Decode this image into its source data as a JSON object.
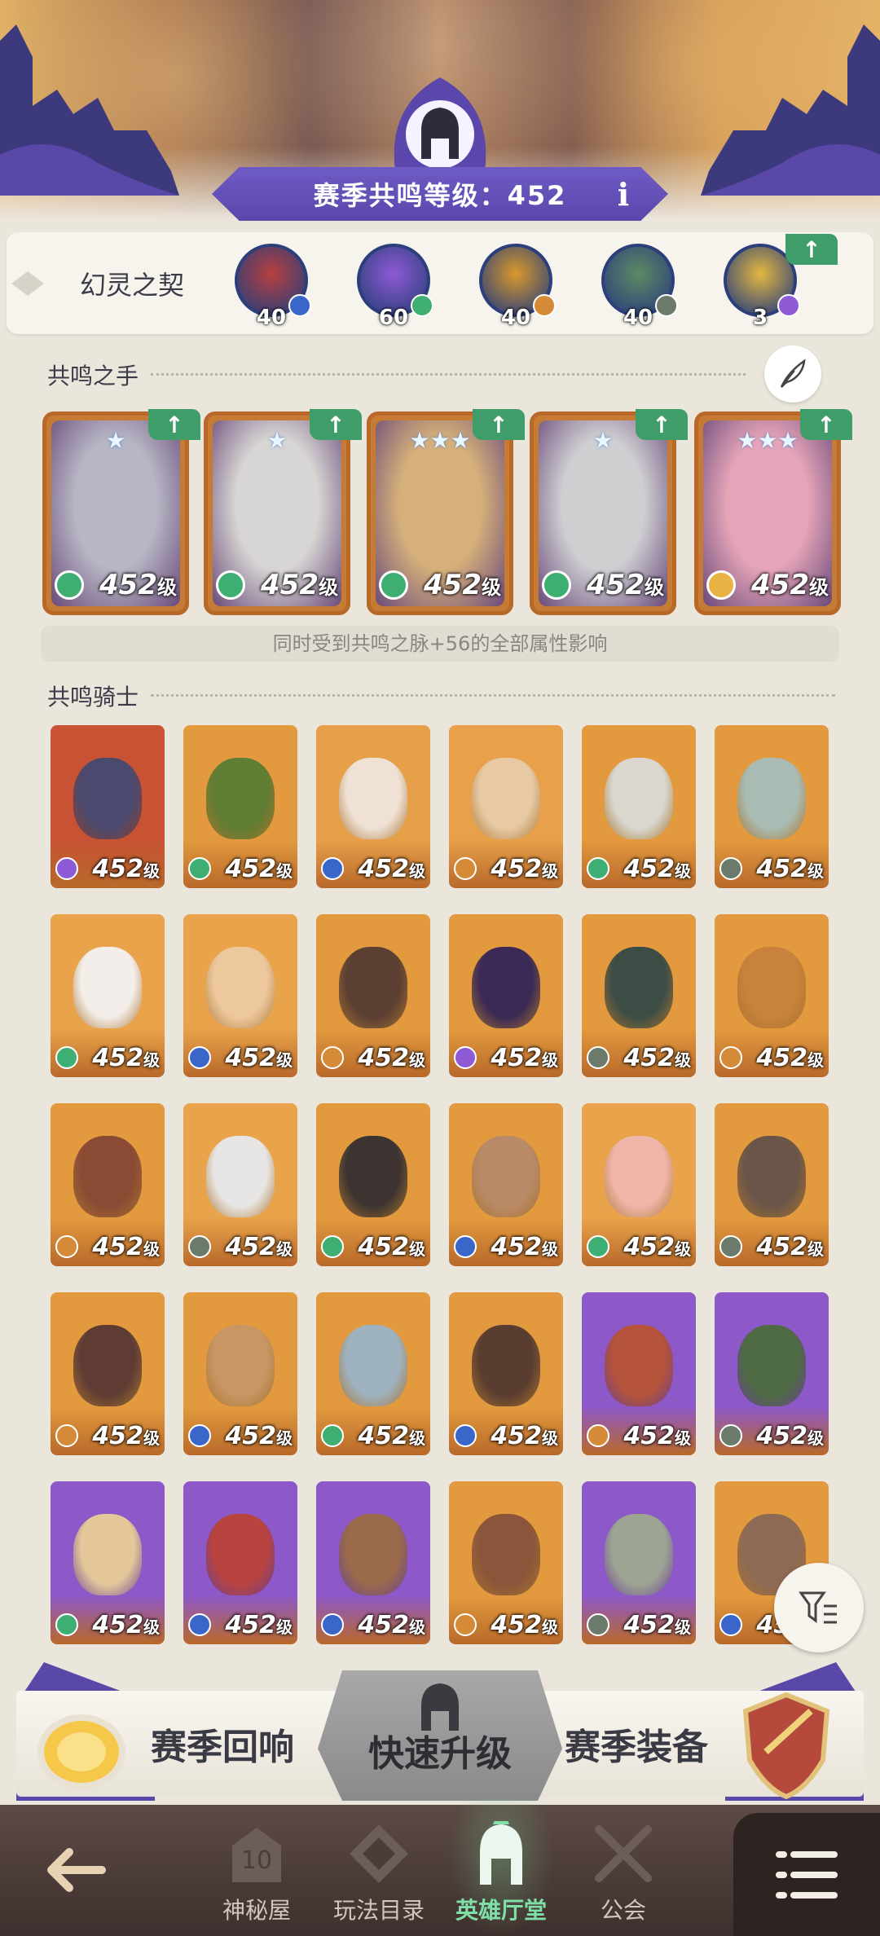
{
  "header": {
    "season_level_label": "赛季共鸣等级：452",
    "info_icon": "i"
  },
  "phantom": {
    "title": "幻灵之契",
    "items": [
      {
        "level": "40",
        "color": "#b63f3f",
        "elem": "#3b66c9"
      },
      {
        "level": "60",
        "color": "#8e5ad6",
        "elem": "#3fae73"
      },
      {
        "level": "40",
        "color": "#d99a2b",
        "elem": "#d48a36"
      },
      {
        "level": "40",
        "color": "#5e8a64",
        "elem": "#6b7a6a"
      },
      {
        "level": "3",
        "color": "#e3b840",
        "elem": "#8e5ad6"
      }
    ],
    "upgrade_badge": "↑"
  },
  "hands": {
    "title": "共鸣之手",
    "items": [
      {
        "stars": "★",
        "level": "452",
        "unit": "级",
        "color": "#b7b6c4",
        "elem": "#3fae73"
      },
      {
        "stars": "★",
        "level": "452",
        "unit": "级",
        "color": "#d8d6d4",
        "elem": "#3fae73"
      },
      {
        "stars": "★★★",
        "level": "452",
        "unit": "级",
        "color": "#d6b07a",
        "elem": "#3fae73"
      },
      {
        "stars": "★",
        "level": "452",
        "unit": "级",
        "color": "#cfcfd2",
        "elem": "#3fae73"
      },
      {
        "stars": "★★★",
        "level": "452",
        "unit": "级",
        "color": "#e5a4b8",
        "elem": "#e9b344"
      }
    ],
    "note": "同时受到共鸣之脉+56的全部属性影响"
  },
  "knights": {
    "title": "共鸣骑士",
    "level": "452",
    "unit": "级",
    "rows": [
      [
        {
          "bg": "#c75234",
          "face": "#4b4a6e",
          "elem": "#8e5ad6"
        },
        {
          "bg": "#e39a3e",
          "face": "#5f7d33",
          "elem": "#3fae73"
        },
        {
          "bg": "#e6a04a",
          "face": "#efe1d4",
          "elem": "#3b66c9"
        },
        {
          "bg": "#e8a04a",
          "face": "#e7c9a3",
          "elem": "#d48a36"
        },
        {
          "bg": "#e39a3e",
          "face": "#d9d7ce",
          "elem": "#3fae73"
        },
        {
          "bg": "#e39a3e",
          "face": "#a9bcb3",
          "elem": "#6b7a6a"
        }
      ],
      [
        {
          "bg": "#e9a34a",
          "face": "#f3eee9",
          "elem": "#3fae73"
        },
        {
          "bg": "#e9a34a",
          "face": "#edc89d",
          "elem": "#3b66c9"
        },
        {
          "bg": "#e39a3e",
          "face": "#5b3f33",
          "elem": "#d48a36"
        },
        {
          "bg": "#e39a3e",
          "face": "#3b2a55",
          "elem": "#8e5ad6"
        },
        {
          "bg": "#e39a3e",
          "face": "#3c4d46",
          "elem": "#6b7a6a"
        },
        {
          "bg": "#e39a3e",
          "face": "#c8823b",
          "elem": "#d48a36"
        }
      ],
      [
        {
          "bg": "#e39a3e",
          "face": "#8a4a34",
          "elem": "#d48a36"
        },
        {
          "bg": "#e9a34a",
          "face": "#e8e6e4",
          "elem": "#6b7a6a"
        },
        {
          "bg": "#e39a3e",
          "face": "#3d3431",
          "elem": "#3fae73"
        },
        {
          "bg": "#e39a3e",
          "face": "#b98a67",
          "elem": "#3b66c9"
        },
        {
          "bg": "#e9a34a",
          "face": "#f0b6a9",
          "elem": "#3fae73"
        },
        {
          "bg": "#e39a3e",
          "face": "#6b5548",
          "elem": "#6b7a6a"
        }
      ],
      [
        {
          "bg": "#e39a3e",
          "face": "#5e3c34",
          "elem": "#d48a36"
        },
        {
          "bg": "#e39a3e",
          "face": "#c79664",
          "elem": "#3b66c9"
        },
        {
          "bg": "#e39a3e",
          "face": "#9fb2c0",
          "elem": "#3fae73"
        },
        {
          "bg": "#e39a3e",
          "face": "#5a3d31",
          "elem": "#3b66c9"
        },
        {
          "bg": "#8d58c8",
          "face": "#b5533b",
          "elem": "#d48a36"
        },
        {
          "bg": "#8d58c8",
          "face": "#4f6b44",
          "elem": "#6b7a6a"
        }
      ],
      [
        {
          "bg": "#8d58c8",
          "face": "#e4c89a",
          "elem": "#3fae73"
        },
        {
          "bg": "#8d58c8",
          "face": "#b8433f",
          "elem": "#3b66c9"
        },
        {
          "bg": "#8d58c8",
          "face": "#9a6a4b",
          "elem": "#3b66c9"
        },
        {
          "bg": "#e39a3e",
          "face": "#8a553a",
          "elem": "#d48a36"
        },
        {
          "bg": "#8d58c8",
          "face": "#9ea494",
          "elem": "#6b7a6a"
        },
        {
          "bg": "#e39a3e",
          "face": "#8d6a55",
          "elem": "#3b66c9"
        }
      ]
    ]
  },
  "actions": {
    "left": "赛季回响",
    "center": "快速升级",
    "right": "赛季装备"
  },
  "nav": {
    "items": [
      {
        "label": "神秘屋"
      },
      {
        "label": "玩法目录"
      },
      {
        "label": "英雄厅堂"
      },
      {
        "label": "公会"
      }
    ]
  }
}
